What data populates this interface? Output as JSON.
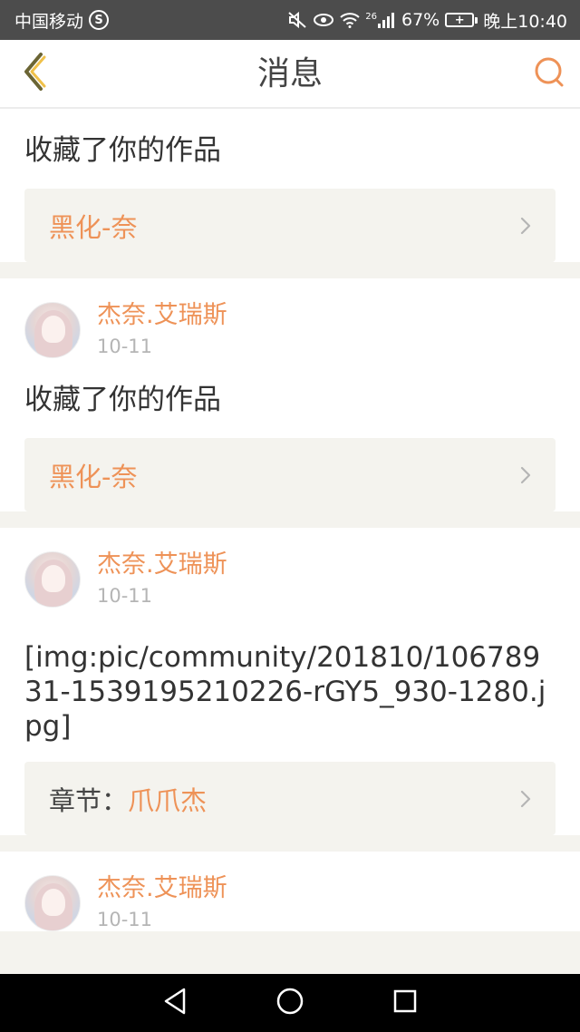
{
  "status_bar": {
    "carrier": "中国移动",
    "carrier_badge": "S",
    "network": "26",
    "battery": "67%",
    "time": "晚上10:40"
  },
  "header": {
    "title": "消息",
    "back_icon": "chevron-left-icon",
    "search_icon": "search-icon",
    "accent_color": "#ee9257"
  },
  "messages": [
    {
      "action": "收藏了你的作品",
      "ref": {
        "prefix": "",
        "title": "黑化-奈"
      }
    },
    {
      "user": "杰奈.艾瑞斯",
      "date": "10-11",
      "action": "收藏了你的作品",
      "ref": {
        "prefix": "",
        "title": "黑化-奈"
      }
    },
    {
      "user": "杰奈.艾瑞斯",
      "date": "10-11",
      "text": "[img:pic/community/201810/10678931-1539195210226-rGY5_930-1280.jpg]",
      "ref": {
        "prefix": "章节：",
        "title": "爪爪杰"
      }
    },
    {
      "user": "杰奈.艾瑞斯",
      "date": "10-11"
    }
  ],
  "nav_bar": {
    "back_icon": "triangle-back-icon",
    "home_icon": "circle-home-icon",
    "recents_icon": "square-recents-icon"
  }
}
